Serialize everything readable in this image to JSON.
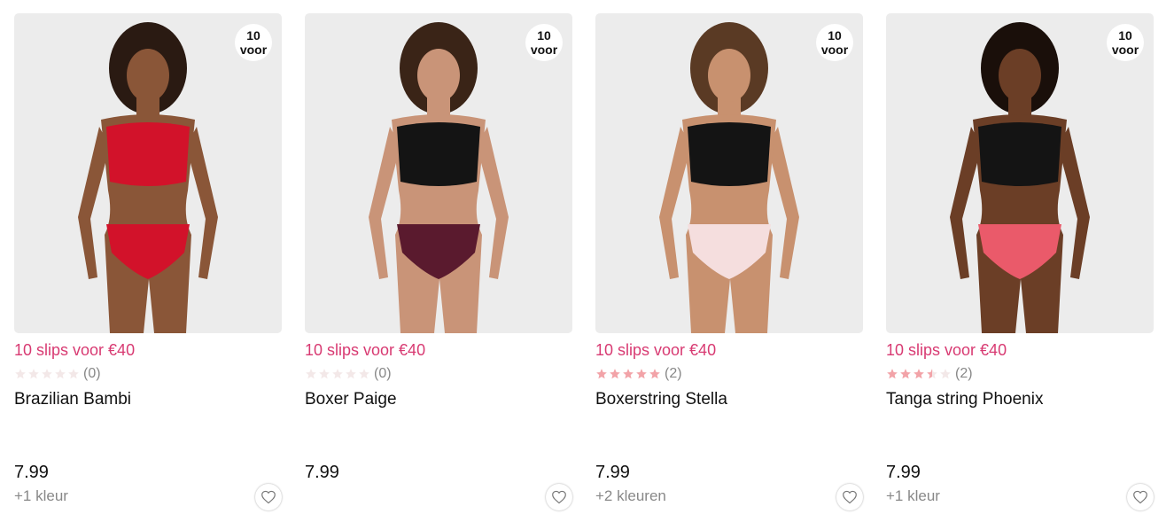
{
  "colors": {
    "promo": "#d83a72",
    "star_filled": "#f2a3a8",
    "star_empty": "#f3e8e8"
  },
  "products": [
    {
      "badge_top": "10",
      "badge_bottom": "voor",
      "promo": "10 slips voor €40",
      "rating": 0,
      "rating_count": "(0)",
      "name": "Brazilian Bambi",
      "price": "7.99",
      "colors_text": "+1 kleur",
      "image": {
        "skin": "#8a5638",
        "hair": "#2a1a12",
        "top": "#d2122a",
        "bottom": "#d2122a"
      }
    },
    {
      "badge_top": "10",
      "badge_bottom": "voor",
      "promo": "10 slips voor €40",
      "rating": 0,
      "rating_count": "(0)",
      "name": "Boxer Paige",
      "price": "7.99",
      "colors_text": "",
      "image": {
        "skin": "#c99478",
        "hair": "#3a2417",
        "top": "#141414",
        "bottom": "#5a1a2e"
      }
    },
    {
      "badge_top": "10",
      "badge_bottom": "voor",
      "promo": "10 slips voor €40",
      "rating": 5,
      "rating_count": "(2)",
      "name": "Boxerstring Stella",
      "price": "7.99",
      "colors_text": "+2 kleuren",
      "image": {
        "skin": "#c8916f",
        "hair": "#5a3a24",
        "top": "#141414",
        "bottom": "#f5dede"
      }
    },
    {
      "badge_top": "10",
      "badge_bottom": "voor",
      "promo": "10 slips voor €40",
      "rating": 3.5,
      "rating_count": "(2)",
      "name": "Tanga string Phoenix",
      "price": "7.99",
      "colors_text": "+1 kleur",
      "image": {
        "skin": "#6b3e26",
        "hair": "#1a0f0a",
        "top": "#141414",
        "bottom": "#ea5a6a"
      }
    }
  ]
}
